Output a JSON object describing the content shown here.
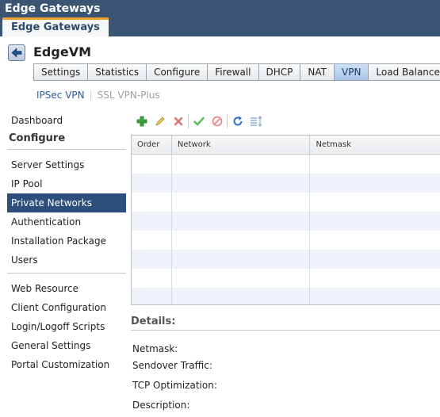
{
  "window": {
    "title": "Edge Gateways",
    "app_tab": "Edge Gateways"
  },
  "header": {
    "vm_name": "EdgeVM"
  },
  "tabs": [
    {
      "label": "Settings",
      "active": false
    },
    {
      "label": "Statistics",
      "active": false
    },
    {
      "label": "Configure",
      "active": false
    },
    {
      "label": "Firewall",
      "active": false
    },
    {
      "label": "DHCP",
      "active": false
    },
    {
      "label": "NAT",
      "active": false
    },
    {
      "label": "VPN",
      "active": true
    },
    {
      "label": "Load Balancer",
      "active": false
    }
  ],
  "subtabs": {
    "ipsec": "IPSec VPN",
    "sslvpn": "SSL VPN-Plus"
  },
  "sidebar": {
    "dashboard": "Dashboard",
    "configure_heading": "Configure",
    "items": [
      "Server Settings",
      "IP Pool",
      "Private Networks",
      "Authentication",
      "Installation Package",
      "Users",
      "Web Resource",
      "Client Configuration",
      "Login/Logoff Scripts",
      "General Settings",
      "Portal Customization"
    ],
    "selected": "Private Networks"
  },
  "toolbar": {
    "icons": [
      "add-icon",
      "edit-icon",
      "delete-icon",
      "enable-icon",
      "disable-icon",
      "refresh-icon",
      "sort-icon"
    ]
  },
  "table": {
    "columns": [
      "Order",
      "Network",
      "Netmask"
    ],
    "rows": []
  },
  "details": {
    "title": "Details:",
    "fields": [
      "Netmask:",
      "Sendover Traffic:",
      "TCP Optimization:",
      "Description:"
    ]
  },
  "colors": {
    "titlebar": "#3b5472",
    "accent_tab": "#f0a030",
    "selected_item": "#2d4f7c",
    "link": "#2a5d9e"
  }
}
